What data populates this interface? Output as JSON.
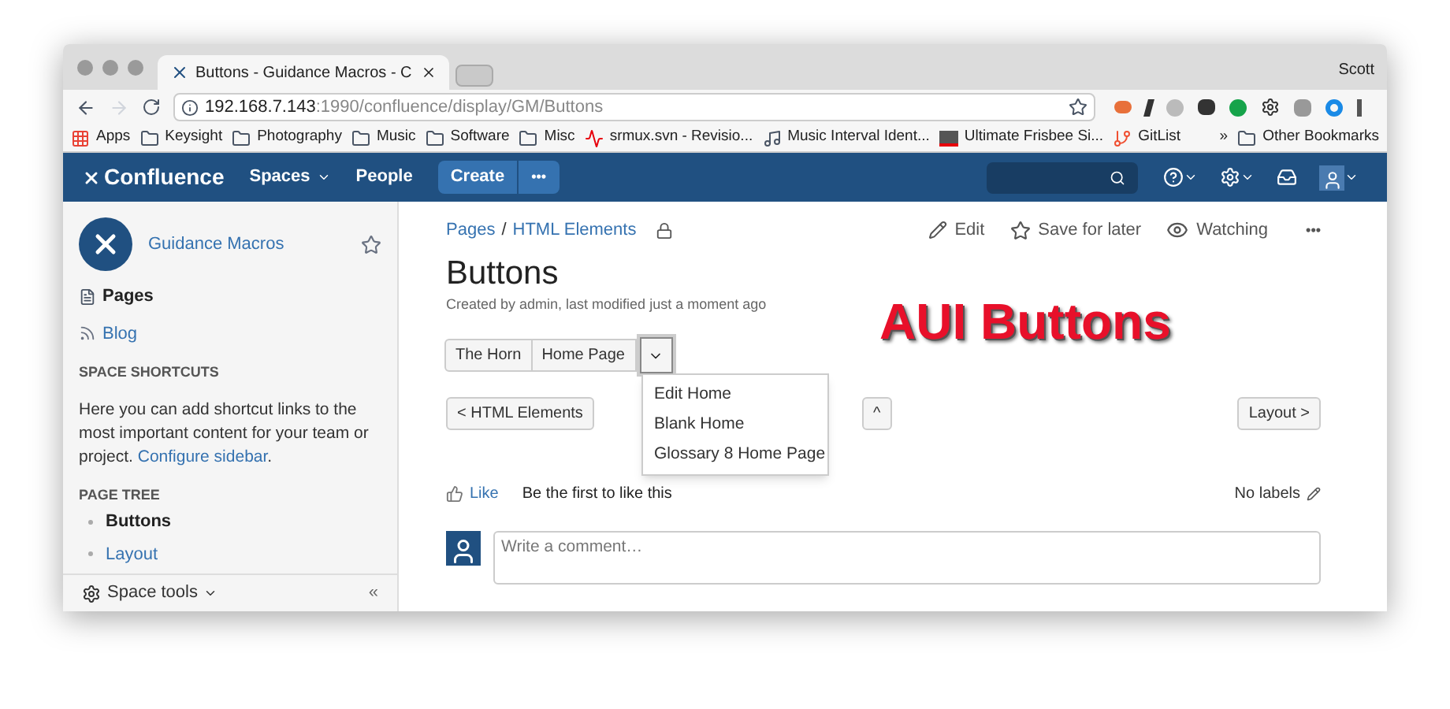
{
  "browser": {
    "tab_title": "Buttons - Guidance Macros - C",
    "user": "Scott",
    "address_host": "192.168.7.143",
    "address_path": ":1990/confluence/display/GM/Buttons",
    "bookmarks": [
      {
        "kind": "apps",
        "label": "Apps"
      },
      {
        "kind": "folder",
        "label": "Keysight"
      },
      {
        "kind": "folder",
        "label": "Photography"
      },
      {
        "kind": "folder",
        "label": "Music"
      },
      {
        "kind": "folder",
        "label": "Software"
      },
      {
        "kind": "folder",
        "label": "Misc"
      },
      {
        "kind": "wave",
        "label": "srmux.svn - Revisio..."
      },
      {
        "kind": "clef",
        "label": "Music Interval Ident..."
      },
      {
        "kind": "flag",
        "label": "Ultimate Frisbee Si..."
      },
      {
        "kind": "git",
        "label": "GitList"
      }
    ],
    "overflow": "»",
    "other_bookmarks": "Other Bookmarks"
  },
  "header": {
    "logo": "Confluence",
    "nav": [
      {
        "label": "Spaces",
        "dropdown": true
      },
      {
        "label": "People",
        "dropdown": false
      }
    ],
    "create": "Create",
    "more": "•••"
  },
  "sidebar": {
    "space_name": "Guidance Macros",
    "links": [
      {
        "kind": "pages",
        "label": "Pages",
        "selected": true
      },
      {
        "kind": "blog",
        "label": "Blog",
        "selected": false
      }
    ],
    "shortcuts_heading": "SPACE SHORTCUTS",
    "shortcuts_text": "Here you can add shortcut links to the most important content for your team or project.",
    "configure_link": "Configure sidebar",
    "period": ".",
    "tree_heading": "PAGE TREE",
    "tree": [
      {
        "label": "Buttons",
        "selected": true
      },
      {
        "label": "Layout",
        "selected": false
      }
    ],
    "space_tools": "Space tools",
    "collapse": "«"
  },
  "page": {
    "breadcrumbs": [
      "Pages",
      "HTML Elements"
    ],
    "separator": "/",
    "actions": [
      {
        "kind": "edit",
        "label": "Edit"
      },
      {
        "kind": "star",
        "label": "Save for later"
      },
      {
        "kind": "eye",
        "label": "Watching"
      }
    ],
    "more": "•••",
    "title": "Buttons",
    "byline": "Created by admin, last modified just a moment ago",
    "annotation": "AUI Buttons",
    "button_group": [
      "The Horn",
      "Home Page"
    ],
    "dropdown_toggle": {
      "expanded": true
    },
    "dropdown_items": [
      "Edit Home",
      "Blank Home",
      "Glossary 8 Home Page"
    ],
    "nav_buttons": [
      "< HTML Elements",
      "^",
      "Layout >"
    ],
    "like": "Like",
    "like_text": "Be the first to like this",
    "labels": "No labels",
    "comment": {
      "placeholder": "Write a comment…"
    }
  }
}
